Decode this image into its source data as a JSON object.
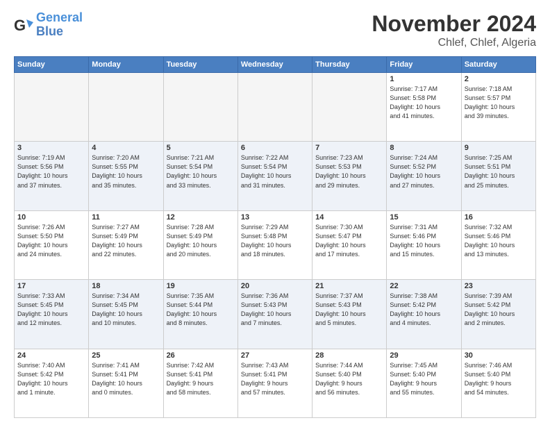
{
  "header": {
    "logo_line1": "General",
    "logo_line2": "Blue",
    "title": "November 2024",
    "subtitle": "Chlef, Chlef, Algeria"
  },
  "days_of_week": [
    "Sunday",
    "Monday",
    "Tuesday",
    "Wednesday",
    "Thursday",
    "Friday",
    "Saturday"
  ],
  "weeks": [
    [
      {
        "day": "",
        "info": ""
      },
      {
        "day": "",
        "info": ""
      },
      {
        "day": "",
        "info": ""
      },
      {
        "day": "",
        "info": ""
      },
      {
        "day": "",
        "info": ""
      },
      {
        "day": "1",
        "info": "Sunrise: 7:17 AM\nSunset: 5:58 PM\nDaylight: 10 hours\nand 41 minutes."
      },
      {
        "day": "2",
        "info": "Sunrise: 7:18 AM\nSunset: 5:57 PM\nDaylight: 10 hours\nand 39 minutes."
      }
    ],
    [
      {
        "day": "3",
        "info": "Sunrise: 7:19 AM\nSunset: 5:56 PM\nDaylight: 10 hours\nand 37 minutes."
      },
      {
        "day": "4",
        "info": "Sunrise: 7:20 AM\nSunset: 5:55 PM\nDaylight: 10 hours\nand 35 minutes."
      },
      {
        "day": "5",
        "info": "Sunrise: 7:21 AM\nSunset: 5:54 PM\nDaylight: 10 hours\nand 33 minutes."
      },
      {
        "day": "6",
        "info": "Sunrise: 7:22 AM\nSunset: 5:54 PM\nDaylight: 10 hours\nand 31 minutes."
      },
      {
        "day": "7",
        "info": "Sunrise: 7:23 AM\nSunset: 5:53 PM\nDaylight: 10 hours\nand 29 minutes."
      },
      {
        "day": "8",
        "info": "Sunrise: 7:24 AM\nSunset: 5:52 PM\nDaylight: 10 hours\nand 27 minutes."
      },
      {
        "day": "9",
        "info": "Sunrise: 7:25 AM\nSunset: 5:51 PM\nDaylight: 10 hours\nand 25 minutes."
      }
    ],
    [
      {
        "day": "10",
        "info": "Sunrise: 7:26 AM\nSunset: 5:50 PM\nDaylight: 10 hours\nand 24 minutes."
      },
      {
        "day": "11",
        "info": "Sunrise: 7:27 AM\nSunset: 5:49 PM\nDaylight: 10 hours\nand 22 minutes."
      },
      {
        "day": "12",
        "info": "Sunrise: 7:28 AM\nSunset: 5:49 PM\nDaylight: 10 hours\nand 20 minutes."
      },
      {
        "day": "13",
        "info": "Sunrise: 7:29 AM\nSunset: 5:48 PM\nDaylight: 10 hours\nand 18 minutes."
      },
      {
        "day": "14",
        "info": "Sunrise: 7:30 AM\nSunset: 5:47 PM\nDaylight: 10 hours\nand 17 minutes."
      },
      {
        "day": "15",
        "info": "Sunrise: 7:31 AM\nSunset: 5:46 PM\nDaylight: 10 hours\nand 15 minutes."
      },
      {
        "day": "16",
        "info": "Sunrise: 7:32 AM\nSunset: 5:46 PM\nDaylight: 10 hours\nand 13 minutes."
      }
    ],
    [
      {
        "day": "17",
        "info": "Sunrise: 7:33 AM\nSunset: 5:45 PM\nDaylight: 10 hours\nand 12 minutes."
      },
      {
        "day": "18",
        "info": "Sunrise: 7:34 AM\nSunset: 5:45 PM\nDaylight: 10 hours\nand 10 minutes."
      },
      {
        "day": "19",
        "info": "Sunrise: 7:35 AM\nSunset: 5:44 PM\nDaylight: 10 hours\nand 8 minutes."
      },
      {
        "day": "20",
        "info": "Sunrise: 7:36 AM\nSunset: 5:43 PM\nDaylight: 10 hours\nand 7 minutes."
      },
      {
        "day": "21",
        "info": "Sunrise: 7:37 AM\nSunset: 5:43 PM\nDaylight: 10 hours\nand 5 minutes."
      },
      {
        "day": "22",
        "info": "Sunrise: 7:38 AM\nSunset: 5:42 PM\nDaylight: 10 hours\nand 4 minutes."
      },
      {
        "day": "23",
        "info": "Sunrise: 7:39 AM\nSunset: 5:42 PM\nDaylight: 10 hours\nand 2 minutes."
      }
    ],
    [
      {
        "day": "24",
        "info": "Sunrise: 7:40 AM\nSunset: 5:42 PM\nDaylight: 10 hours\nand 1 minute."
      },
      {
        "day": "25",
        "info": "Sunrise: 7:41 AM\nSunset: 5:41 PM\nDaylight: 10 hours\nand 0 minutes."
      },
      {
        "day": "26",
        "info": "Sunrise: 7:42 AM\nSunset: 5:41 PM\nDaylight: 9 hours\nand 58 minutes."
      },
      {
        "day": "27",
        "info": "Sunrise: 7:43 AM\nSunset: 5:41 PM\nDaylight: 9 hours\nand 57 minutes."
      },
      {
        "day": "28",
        "info": "Sunrise: 7:44 AM\nSunset: 5:40 PM\nDaylight: 9 hours\nand 56 minutes."
      },
      {
        "day": "29",
        "info": "Sunrise: 7:45 AM\nSunset: 5:40 PM\nDaylight: 9 hours\nand 55 minutes."
      },
      {
        "day": "30",
        "info": "Sunrise: 7:46 AM\nSunset: 5:40 PM\nDaylight: 9 hours\nand 54 minutes."
      }
    ]
  ]
}
